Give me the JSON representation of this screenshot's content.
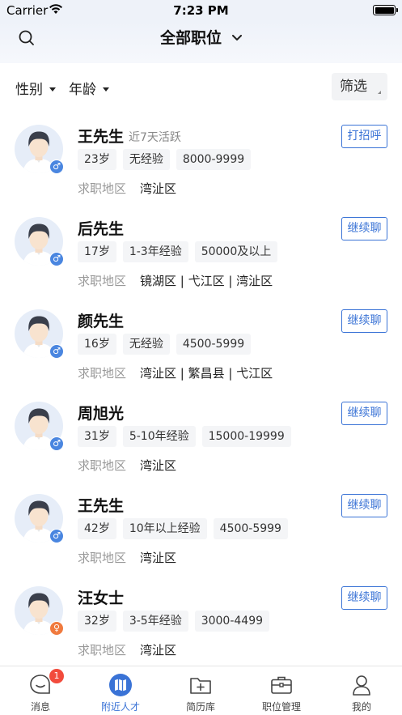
{
  "status_bar": {
    "carrier": "Carrier",
    "time": "7:23 PM"
  },
  "header": {
    "title": "全部职位"
  },
  "filters": {
    "gender": "性别",
    "age": "年龄",
    "screen": "筛选"
  },
  "region_label": "求职地区",
  "candidates": [
    {
      "name": "王先生",
      "active": "近7天活跃",
      "gender": "male",
      "age": "23岁",
      "experience": "无经验",
      "salary": "8000-9999",
      "region": "湾沚区",
      "action": "打招呼"
    },
    {
      "name": "后先生",
      "active": "",
      "gender": "male",
      "age": "17岁",
      "experience": "1-3年经验",
      "salary": "50000及以上",
      "region": "镜湖区 | 弋江区 | 湾沚区",
      "action": "继续聊"
    },
    {
      "name": "颜先生",
      "active": "",
      "gender": "male",
      "age": "16岁",
      "experience": "无经验",
      "salary": "4500-5999",
      "region": "湾沚区 | 繁昌县 | 弋江区",
      "action": "继续聊"
    },
    {
      "name": "周旭光",
      "active": "",
      "gender": "male",
      "age": "31岁",
      "experience": "5-10年经验",
      "salary": "15000-19999",
      "region": "湾沚区",
      "action": "继续聊"
    },
    {
      "name": "王先生",
      "active": "",
      "gender": "male",
      "age": "42岁",
      "experience": "10年以上经验",
      "salary": "4500-5999",
      "region": "湾沚区",
      "action": "继续聊"
    },
    {
      "name": "汪女士",
      "active": "",
      "gender": "female",
      "age": "32岁",
      "experience": "3-5年经验",
      "salary": "3000-4499",
      "region": "湾沚区",
      "action": "继续聊"
    }
  ],
  "tabbar": {
    "messages": "消息",
    "messages_badge": "1",
    "nearby": "附近人才",
    "resumes": "简历库",
    "jobs": "职位管理",
    "mine": "我的"
  },
  "colors": {
    "accent": "#3a73d6",
    "badge": "#f24b3c",
    "male": "#4a86e0",
    "female": "#f07a3e"
  }
}
